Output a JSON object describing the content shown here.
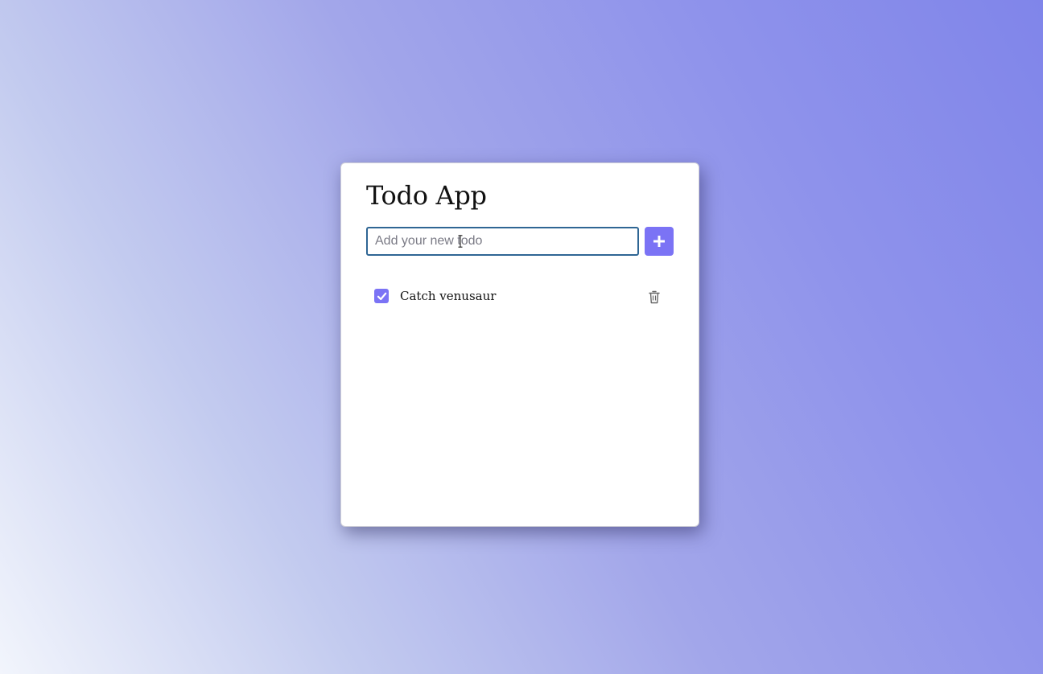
{
  "app": {
    "title": "Todo App"
  },
  "new_todo": {
    "placeholder": "Add your new todo",
    "value": "",
    "add_icon": "plus-icon"
  },
  "todos": [
    {
      "label": "Catch venusaur",
      "checked": true,
      "check_icon": "check-icon",
      "delete_icon": "trash-icon"
    }
  ],
  "colors": {
    "accent": "#7b73f5",
    "input_border": "#2f6694",
    "card_background": "#ffffff"
  }
}
